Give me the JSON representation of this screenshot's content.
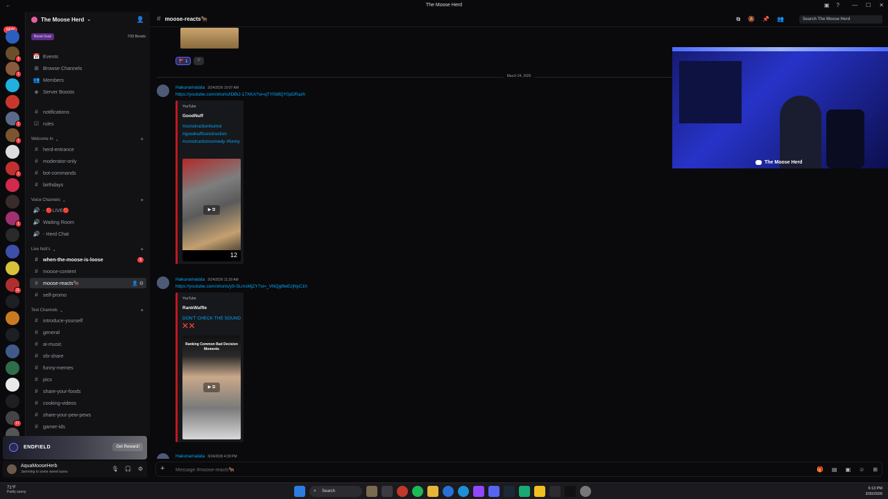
{
  "window": {
    "title": "The Moose Herd",
    "controls": [
      "—",
      "☐",
      "✕"
    ]
  },
  "server_rail": {
    "new_label": "NEW",
    "badges": [
      "1",
      "1",
      "1",
      "1",
      "1",
      "1",
      "11",
      "17",
      "1",
      "1"
    ]
  },
  "guild": {
    "name": "The Moose Herd",
    "boost_goal": "Boost Goal",
    "boost_count": "7/33 Boosts"
  },
  "nav": [
    {
      "icon": "📅",
      "label": "Events"
    },
    {
      "icon": "⊞",
      "label": "Browse Channels"
    },
    {
      "icon": "👥",
      "label": "Members"
    },
    {
      "icon": "◈",
      "label": "Server Boosts"
    }
  ],
  "top_channels": [
    {
      "label": "notifications",
      "icon": "#"
    },
    {
      "label": "rules",
      "icon": "☑"
    }
  ],
  "categories": {
    "welcome": "Welcome In",
    "voice": "Voice Channels",
    "live": "Live Noti's",
    "text": "Text Channels"
  },
  "welcome_channels": [
    "herd-entrance",
    "moderator-only",
    "bot-commands",
    "birthdays"
  ],
  "voice_channels": [
    "- 🔴LIVE🔴",
    "Waiting Room",
    "- Herd Chat"
  ],
  "live_channels": [
    {
      "label": "when-the-moose-is-loose",
      "unread": true,
      "badge": "1"
    },
    {
      "label": "moose-content"
    },
    {
      "label": "moose-reacts🐂",
      "selected": true
    },
    {
      "label": "self-promo"
    }
  ],
  "text_channels": [
    "introduce-yourself",
    "general",
    "ai-music",
    "sfx-share",
    "funny-memes",
    "pics",
    "share-your-foods",
    "cooking-videos",
    "share-your-pew-pews",
    "gamer-ids"
  ],
  "promo": {
    "brand": "ENDFIELD",
    "button": "Get Reward!"
  },
  "user": {
    "name": "AquaMooseHerb",
    "status": "Jamming to some sweet tunes"
  },
  "channel_header": {
    "name": "moose-reacts🐂",
    "search_placeholder": "Search The Moose Herd"
  },
  "chat": {
    "reaction_count": "1",
    "date_divider": "March 24, 2026",
    "messages": [
      {
        "user": "Hakunamatata",
        "time": "3/24/2026 10:07 AM",
        "link": "https://youtube.com/shorts/lDBtJ-17XKA?si=qTYl0dfQY0pDRazh",
        "provider": "YouTube",
        "author": "GoodNuff",
        "title": "#constructionhumor #goodnuffconstruction #constructioncomedy #funny",
        "overlay": "12"
      },
      {
        "user": "Hakunamatata",
        "time": "3/24/2026 11:29 AM",
        "link": "https://youtube.com/shorts/y9-SLmsMjZY?si=_VNQgl9eEzjNyC1h",
        "provider": "YouTube",
        "author": "RankWaffle",
        "title": "DON'T CHECK THE SOUND ❌ ❌",
        "thumb_heading": "Ranking Common Bad Decision Moments"
      },
      {
        "user": "Hakunamatata",
        "time": "3/24/2026 4:30 PM"
      }
    ]
  },
  "webcam": {
    "label": "The Moose Herd"
  },
  "composer": {
    "placeholder": "Message #moose-reacts🐂"
  },
  "taskbar": {
    "temp": "71°F",
    "weather": "Partly sunny",
    "search": "Search",
    "time": "6:13 PM",
    "date": "3/30/2026"
  },
  "colors": {
    "accent": "#5865f2",
    "link": "#00a8fc",
    "badge": "#f23f42",
    "embed_border": "#c4161c"
  }
}
